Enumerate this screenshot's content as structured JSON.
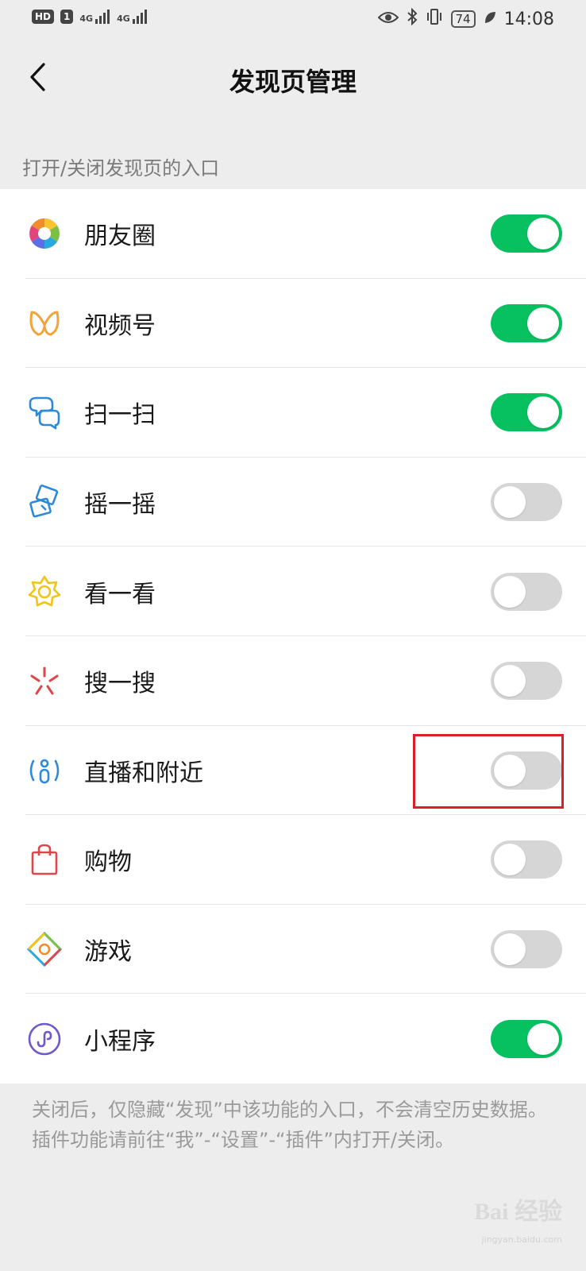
{
  "status_bar": {
    "hd_label": "HD",
    "sim_label": "1",
    "signal1": "4G",
    "signal2": "4G",
    "battery": "74",
    "time": "14:08"
  },
  "nav": {
    "back_icon": "chevron-left-icon",
    "title": "发现页管理"
  },
  "section_label": "打开/关闭发现页的入口",
  "items": [
    {
      "label": "朋友圈",
      "icon": "moments-aperture-icon",
      "on": true
    },
    {
      "label": "视频号",
      "icon": "channels-butterfly-icon",
      "on": true
    },
    {
      "label": "扫一扫",
      "icon": "scan-icon",
      "on": true
    },
    {
      "label": "摇一摇",
      "icon": "shake-icon",
      "on": false
    },
    {
      "label": "看一看",
      "icon": "top-stories-star-icon",
      "on": false
    },
    {
      "label": "搜一搜",
      "icon": "search-sparkle-icon",
      "on": false
    },
    {
      "label": "直播和附近",
      "icon": "live-nearby-person-icon",
      "on": false
    },
    {
      "label": "购物",
      "icon": "shopping-bag-icon",
      "on": false
    },
    {
      "label": "游戏",
      "icon": "games-diamond-icon",
      "on": false
    },
    {
      "label": "小程序",
      "icon": "mini-program-icon",
      "on": true
    }
  ],
  "footer_note": "关闭后，仅隐藏“发现”中该功能的入口，不会清空历史数据。插件功能请前往“我”-“设置”-“插件”内打开/关闭。",
  "watermark": {
    "main": "Bai 经验",
    "sub": "jingyan.baidu.com"
  },
  "colors": {
    "toggle_on": "#07c160",
    "toggle_off": "#d6d6d6",
    "highlight": "#d9202a"
  }
}
